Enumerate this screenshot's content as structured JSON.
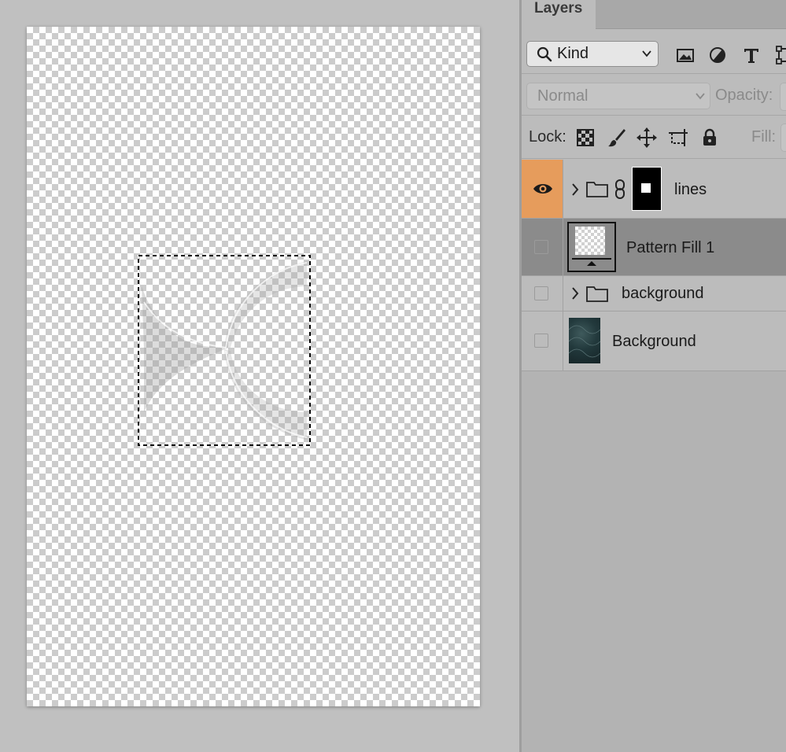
{
  "panel": {
    "tab_label": "Layers",
    "filter": {
      "kind_label": "Kind"
    },
    "blend_mode": "Normal",
    "opacity_label": "Opacity:",
    "lock_label": "Lock:",
    "fill_label": "Fill:"
  },
  "layers": [
    {
      "name": "lines",
      "type": "group",
      "visible": true,
      "selected": false
    },
    {
      "name": "Pattern Fill 1",
      "type": "fill-layer",
      "visible": false,
      "selected": true
    },
    {
      "name": "background",
      "type": "group",
      "visible": false,
      "selected": false
    },
    {
      "name": "Background",
      "type": "image",
      "visible": false,
      "selected": false
    }
  ],
  "colors": {
    "visibility_highlight": "#e69c5c",
    "selected_row": "#8b8b8b",
    "panel_bg": "#bcbcbc",
    "workspace_bg": "#c0c0c0"
  },
  "icons": [
    "search-icon",
    "image-filter-icon",
    "adjustment-filter-icon",
    "type-filter-icon",
    "shape-filter-icon",
    "lock-pixels-icon",
    "lock-brush-icon",
    "lock-move-icon",
    "lock-artboard-icon",
    "lock-all-icon",
    "eye-icon",
    "chevron-right-icon",
    "folder-icon",
    "link-icon"
  ]
}
